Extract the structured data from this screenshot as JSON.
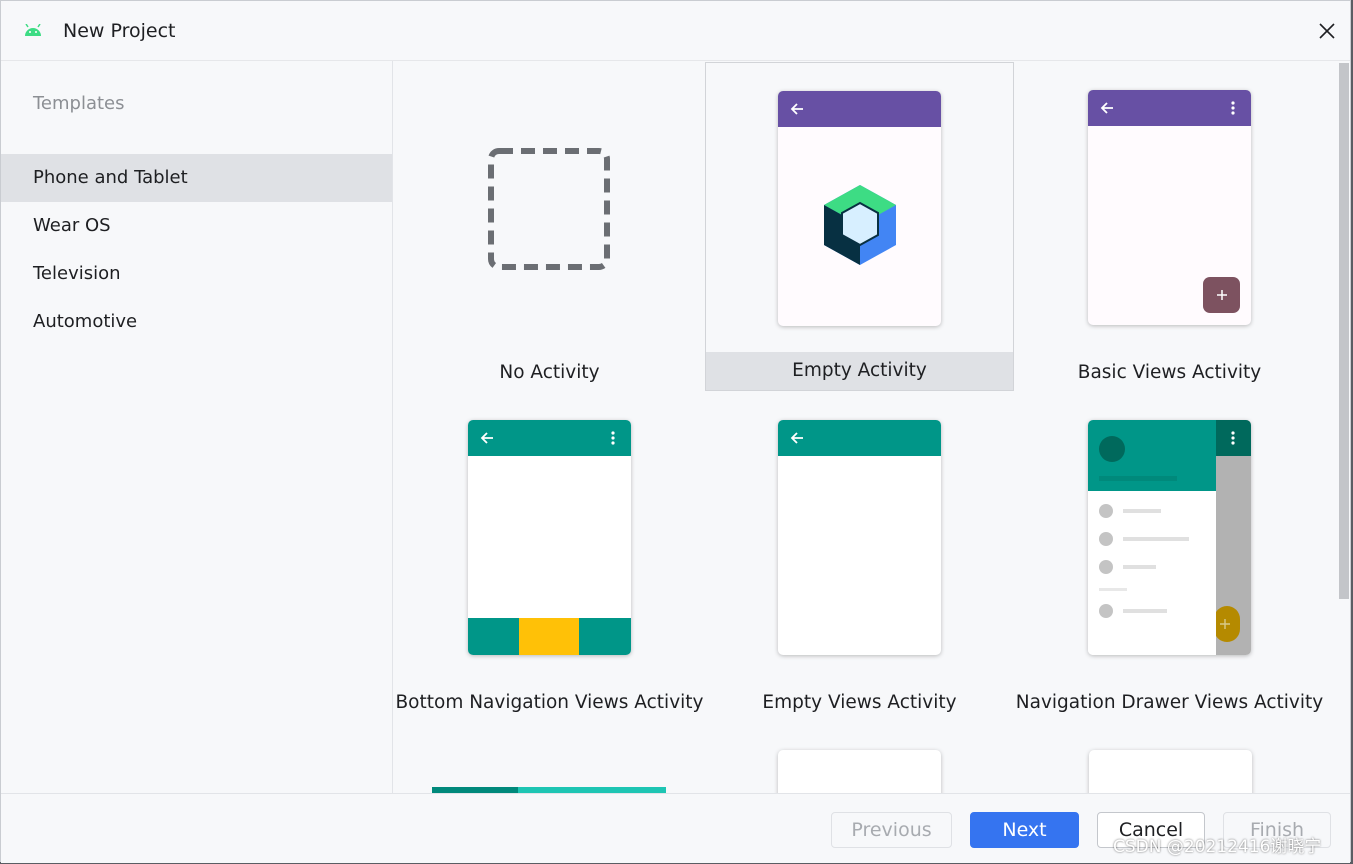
{
  "window": {
    "title": "New Project"
  },
  "sidebar": {
    "header": "Templates",
    "items": [
      {
        "label": "Phone and Tablet",
        "selected": true
      },
      {
        "label": "Wear OS",
        "selected": false
      },
      {
        "label": "Television",
        "selected": false
      },
      {
        "label": "Automotive",
        "selected": false
      }
    ]
  },
  "templates": [
    {
      "label": "No Activity",
      "selected": false
    },
    {
      "label": "Empty Activity",
      "selected": true
    },
    {
      "label": "Basic Views Activity",
      "selected": false
    },
    {
      "label": "Bottom Navigation Views Activity",
      "selected": false
    },
    {
      "label": "Empty Views Activity",
      "selected": false
    },
    {
      "label": "Navigation Drawer Views Activity",
      "selected": false
    }
  ],
  "buttons": {
    "previous": "Previous",
    "next": "Next",
    "cancel": "Cancel",
    "finish": "Finish"
  },
  "colors": {
    "accent": "#3574f0",
    "purple_appbar": "#6750a4",
    "teal_appbar": "#009688",
    "fab_purple": "#7d5260",
    "bottom_nav_yellow": "#ffc107"
  },
  "watermark": "CSDN @20212416谢晓宁"
}
